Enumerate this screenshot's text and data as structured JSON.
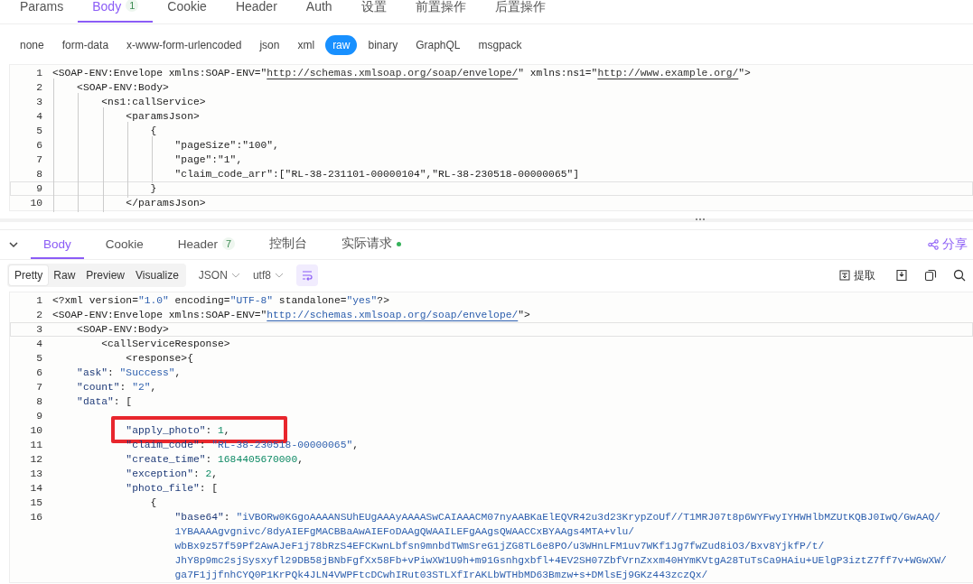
{
  "request_tabs": [
    {
      "label": "Params",
      "selected": false
    },
    {
      "label": "Body",
      "badge": "1",
      "selected": true
    },
    {
      "label": "Cookie",
      "selected": false
    },
    {
      "label": "Header",
      "selected": false
    },
    {
      "label": "Auth",
      "selected": false
    },
    {
      "label": "设置",
      "selected": false
    },
    {
      "label": "前置操作",
      "selected": false
    },
    {
      "label": "后置操作",
      "selected": false
    }
  ],
  "body_types": [
    {
      "label": "none",
      "selected": false
    },
    {
      "label": "form-data",
      "selected": false
    },
    {
      "label": "x-www-form-urlencoded",
      "selected": false
    },
    {
      "label": "json",
      "selected": false
    },
    {
      "label": "xml",
      "selected": false
    },
    {
      "label": "raw",
      "selected": true
    },
    {
      "label": "binary",
      "selected": false
    },
    {
      "label": "GraphQL",
      "selected": false
    },
    {
      "label": "msgpack",
      "selected": false
    }
  ],
  "request_editor": {
    "lines": [
      {
        "number": "1",
        "active": false,
        "tokens": [
          {
            "kind": "plain",
            "text": "<SOAP-ENV:Envelope xmlns:SOAP-ENV=\""
          },
          {
            "kind": "link",
            "text": "http://schemas.xmlsoap.org/soap/envelope/"
          },
          {
            "kind": "plain",
            "text": "\" xmlns:ns1=\""
          },
          {
            "kind": "link",
            "text": "http://www.example.org/"
          },
          {
            "kind": "plain",
            "text": "\">"
          }
        ]
      },
      {
        "number": "2",
        "active": false,
        "tokens": [
          {
            "kind": "plain",
            "text": "    <SOAP-ENV:Body>"
          }
        ]
      },
      {
        "number": "3",
        "active": false,
        "tokens": [
          {
            "kind": "plain",
            "text": "        <ns1:callService>"
          }
        ]
      },
      {
        "number": "4",
        "active": false,
        "tokens": [
          {
            "kind": "plain",
            "text": "            <paramsJson>"
          }
        ]
      },
      {
        "number": "5",
        "active": false,
        "tokens": [
          {
            "kind": "plain",
            "text": "                {"
          }
        ]
      },
      {
        "number": "6",
        "active": false,
        "tokens": [
          {
            "kind": "plain",
            "text": "                    \"pageSize\":\"100\","
          }
        ]
      },
      {
        "number": "7",
        "active": false,
        "tokens": [
          {
            "kind": "plain",
            "text": "                    \"page\":\"1\","
          }
        ]
      },
      {
        "number": "8",
        "active": false,
        "tokens": [
          {
            "kind": "plain",
            "text": "                    \"claim_code_arr\":[\"RL-38-231101-00000104\",\"RL-38-230518-00000065\"]"
          }
        ]
      },
      {
        "number": "9",
        "active": true,
        "tokens": [
          {
            "kind": "plain",
            "text": "                }"
          }
        ]
      },
      {
        "number": "10",
        "active": false,
        "tokens": [
          {
            "kind": "plain",
            "text": "            </paramsJson>"
          }
        ]
      }
    ]
  },
  "response_tabs": [
    {
      "label": "Body",
      "selected": true
    },
    {
      "label": "Cookie",
      "selected": false
    },
    {
      "label": "Header",
      "badge": "7",
      "selected": false
    },
    {
      "label": "控制台",
      "selected": false
    },
    {
      "label": "实际请求",
      "dot": true,
      "selected": false
    }
  ],
  "share": {
    "label": "分享"
  },
  "view_modes": [
    {
      "label": "Pretty",
      "selected": true
    },
    {
      "label": "Raw",
      "selected": false
    },
    {
      "label": "Preview",
      "selected": false
    },
    {
      "label": "Visualize",
      "selected": false
    }
  ],
  "format_dropdown": "JSON",
  "encoding_dropdown": "utf8",
  "wrap_on": true,
  "extract": {
    "label": "提取"
  },
  "response_editor": {
    "lines": [
      {
        "number": "1",
        "active": false,
        "tokens": [
          {
            "kind": "plain",
            "text": "<?xml version="
          },
          {
            "kind": "string",
            "text": "\"1.0\""
          },
          {
            "kind": "plain",
            "text": " encoding="
          },
          {
            "kind": "string",
            "text": "\"UTF-8\""
          },
          {
            "kind": "plain",
            "text": " standalone="
          },
          {
            "kind": "string",
            "text": "\"yes\""
          },
          {
            "kind": "plain",
            "text": "?>"
          }
        ]
      },
      {
        "number": "2",
        "active": false,
        "tokens": [
          {
            "kind": "plain",
            "text": "<SOAP-ENV:Envelope xmlns:SOAP-ENV=\""
          },
          {
            "kind": "link",
            "text": "http://schemas.xmlsoap.org/soap/envelope/"
          },
          {
            "kind": "plain",
            "text": "\">"
          }
        ]
      },
      {
        "number": "3",
        "active": true,
        "tokens": [
          {
            "kind": "plain",
            "text": "    <SOAP-ENV:Body>"
          }
        ]
      },
      {
        "number": "4",
        "active": false,
        "tokens": [
          {
            "kind": "plain",
            "text": "        <callServiceResponse>"
          }
        ]
      },
      {
        "number": "5",
        "active": false,
        "tokens": [
          {
            "kind": "plain",
            "text": "            <response>{"
          }
        ]
      },
      {
        "number": "6",
        "active": false,
        "tokens": [
          {
            "kind": "key",
            "text": "    \"ask\""
          },
          {
            "kind": "plain",
            "text": ": "
          },
          {
            "kind": "string",
            "text": "\"Success\""
          },
          {
            "kind": "plain",
            "text": ","
          }
        ]
      },
      {
        "number": "7",
        "active": false,
        "tokens": [
          {
            "kind": "key",
            "text": "    \"count\""
          },
          {
            "kind": "plain",
            "text": ": "
          },
          {
            "kind": "string",
            "text": "\"2\""
          },
          {
            "kind": "plain",
            "text": ","
          }
        ]
      },
      {
        "number": "8",
        "active": false,
        "tokens": [
          {
            "kind": "key",
            "text": "    \"data\""
          },
          {
            "kind": "plain",
            "text": ": ["
          }
        ]
      },
      {
        "number": "9",
        "active": false
      },
      {
        "number": "10",
        "active": false,
        "highlighted": true,
        "tokens": [
          {
            "kind": "key",
            "text": "            \"apply_photo\""
          },
          {
            "kind": "plain",
            "text": ": "
          },
          {
            "kind": "number",
            "text": "1"
          },
          {
            "kind": "plain",
            "text": ","
          }
        ]
      },
      {
        "number": "11",
        "active": false,
        "tokens": [
          {
            "kind": "key",
            "text": "            \"claim_code\""
          },
          {
            "kind": "plain",
            "text": ": "
          },
          {
            "kind": "string",
            "text": "\"RL-38-230518-00000065\""
          },
          {
            "kind": "plain",
            "text": ","
          }
        ]
      },
      {
        "number": "12",
        "active": false,
        "tokens": [
          {
            "kind": "key",
            "text": "            \"create_time\""
          },
          {
            "kind": "plain",
            "text": ": "
          },
          {
            "kind": "number",
            "text": "1684405670000"
          },
          {
            "kind": "plain",
            "text": ","
          }
        ]
      },
      {
        "number": "13",
        "active": false,
        "tokens": [
          {
            "kind": "key",
            "text": "            \"exception\""
          },
          {
            "kind": "plain",
            "text": ": "
          },
          {
            "kind": "number",
            "text": "2"
          },
          {
            "kind": "plain",
            "text": ","
          }
        ]
      },
      {
        "number": "14",
        "active": false,
        "tokens": [
          {
            "kind": "key",
            "text": "            \"photo_file\""
          },
          {
            "kind": "plain",
            "text": ": ["
          }
        ]
      },
      {
        "number": "15",
        "active": false,
        "tokens": [
          {
            "kind": "plain",
            "text": "                {"
          }
        ]
      },
      {
        "number": "16",
        "active": false,
        "tokens": [
          {
            "kind": "key",
            "text": "                    \"base64\""
          },
          {
            "kind": "plain",
            "text": ": "
          },
          {
            "kind": "string",
            "text": "\"iVBORw0KGgoAAAANSUhEUgAAAyAAAASwCAIAAACM07nyAABKaElEQVR42u3d23KrypZoUf//T1MRJ07t8p6WYFwyIYHWHlbMZUtKQBJ0IwQ/GwAAQ/"
          }
        ]
      },
      {
        "active": false,
        "tokens": [
          {
            "kind": "string",
            "text": "                    1YBAAAAgvgnivc/8dyAIEFgMACBBaAwAIEFoDAAgQWAAILEFgAAgsQWAACCxBYAAgs4MTA+vlu/"
          }
        ]
      },
      {
        "active": false,
        "tokens": [
          {
            "kind": "string",
            "text": "                    wbBx9z57f59Pf2AwAJeF1j78bRzS4EFCKwnLbfsn9mnbdTWmSreG1jZG8TL6e8PO/u3WHnLFM1uv7WKf1Jg7fwZud8iO3/Bxv8YjkfP/t/"
          }
        ]
      },
      {
        "active": false,
        "tokens": [
          {
            "kind": "string",
            "text": "                    JhY8p9mc2sjSysxyfl29DB58jBNbFgfXx58Fb+vPiwXW1U9h+m91Gsnhgxbfl+4EV2SH07ZbfVrnZxxm40HYmKVtgA28TuTsCa9HAiu+UElgP3iztZ7ff7v+WGwXW/"
          }
        ]
      },
      {
        "active": false,
        "tokens": [
          {
            "kind": "string",
            "text": "                    ga7F1jjfnhCYQ0P1KrPQk4JLN4VWPFtcDCwhIRut03STLXfIrAKLbWTHbMD63Bmzw+s+DMlsEj9GKz443zczQx/"
          }
        ]
      }
    ]
  }
}
